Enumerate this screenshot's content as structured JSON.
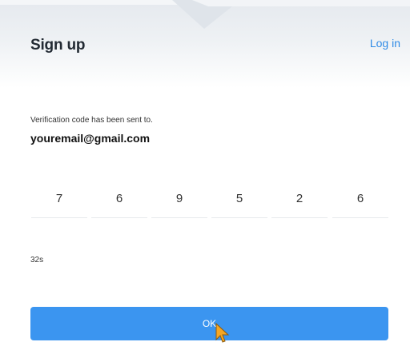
{
  "header": {
    "title": "Sign up",
    "login_label": "Log in"
  },
  "verification": {
    "message": "Verification code has been sent to.",
    "email": "youremail@gmail.com",
    "code_digits": [
      "7",
      "6",
      "9",
      "5",
      "2",
      "6"
    ],
    "timer": "32s"
  },
  "actions": {
    "ok_label": "OK"
  },
  "colors": {
    "accent": "#3b95f0",
    "link": "#2f8be6",
    "cursor": "#f5a623"
  },
  "icons": {
    "cursor": "mouse-pointer-icon"
  }
}
